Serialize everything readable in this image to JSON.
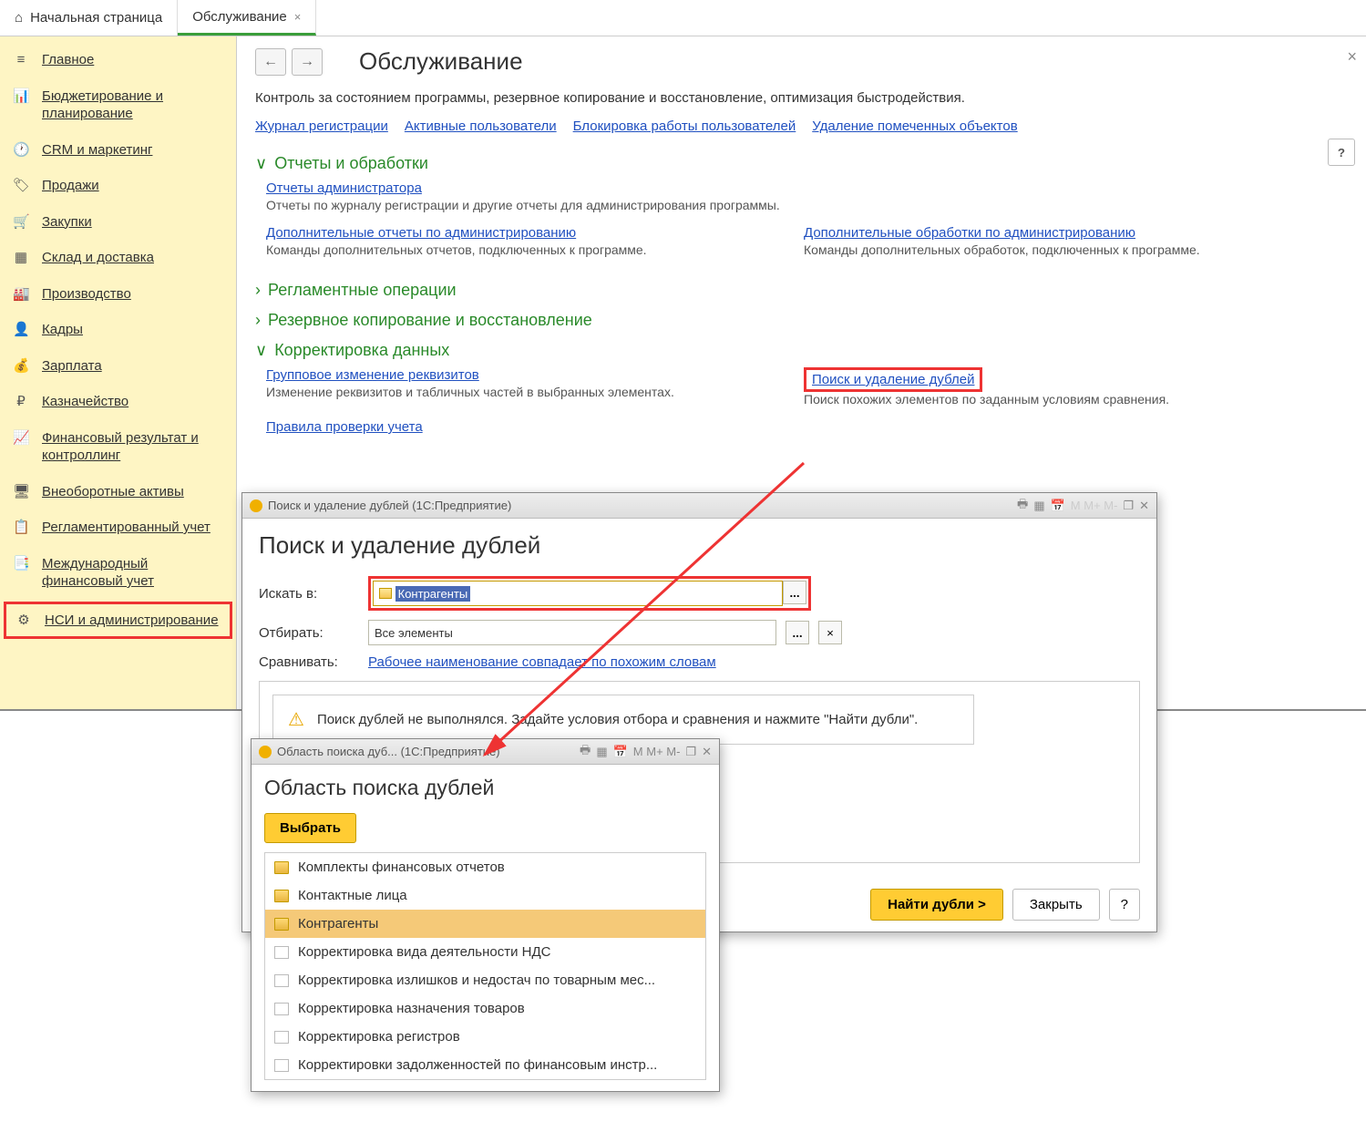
{
  "tabs": {
    "home": "Начальная страница",
    "active": "Обслуживание"
  },
  "sidebar": [
    {
      "icon": "≡",
      "label": "Главное"
    },
    {
      "icon": "📊",
      "label": "Бюджетирование и планирование"
    },
    {
      "icon": "🕐",
      "label": "CRM и маркетинг"
    },
    {
      "icon": "🏷",
      "label": "Продажи"
    },
    {
      "icon": "🛒",
      "label": "Закупки"
    },
    {
      "icon": "▦",
      "label": "Склад и доставка"
    },
    {
      "icon": "🏭",
      "label": "Производство"
    },
    {
      "icon": "👤",
      "label": "Кадры"
    },
    {
      "icon": "💰",
      "label": "Зарплата"
    },
    {
      "icon": "₽",
      "label": "Казначейство"
    },
    {
      "icon": "📈",
      "label": "Финансовый результат и контроллинг"
    },
    {
      "icon": "🖥",
      "label": "Внеоборотные активы"
    },
    {
      "icon": "📋",
      "label": "Регламентированный учет"
    },
    {
      "icon": "📑",
      "label": "Международный финансовый учет"
    },
    {
      "icon": "⚙",
      "label": "НСИ и администрирование"
    }
  ],
  "main": {
    "title": "Обслуживание",
    "desc": "Контроль за состоянием программы, резервное копирование и восстановление, оптимизация быстродействия.",
    "links": [
      "Журнал регистрации",
      "Активные пользователи",
      "Блокировка работы пользователей",
      "Удаление помеченных объектов"
    ],
    "s1": {
      "head": "Отчеты и обработки",
      "l1": "Отчеты администратора",
      "d1": "Отчеты по журналу регистрации и другие отчеты для администрирования программы.",
      "l2": "Дополнительные отчеты по администрированию",
      "d2": "Команды дополнительных отчетов, подключенных к программе.",
      "l3": "Дополнительные обработки по администрированию",
      "d3": "Команды дополнительных обработок, подключенных к программе."
    },
    "s2": "Регламентные операции",
    "s3": "Резервное копирование и восстановление",
    "s4": {
      "head": "Корректировка данных",
      "l1": "Групповое изменение реквизитов",
      "d1": "Изменение реквизитов и табличных частей в выбранных элементах.",
      "l2": "Поиск и удаление дублей",
      "d2": "Поиск похожих элементов по заданным условиям сравнения.",
      "l3": "Правила проверки учета"
    }
  },
  "d1": {
    "wintitle": "Поиск и удаление дублей  (1С:Предприятие)",
    "title": "Поиск и удаление дублей",
    "lbl_search": "Искать в:",
    "val_search": "Контрагенты",
    "lbl_filter": "Отбирать:",
    "val_filter": "Все элементы",
    "lbl_cmp": "Сравнивать:",
    "val_cmp": "Рабочее наименование совпадает по похожим словам",
    "msg": "Поиск дублей не выполнялся.  Задайте условия отбора и сравнения и нажмите \"Найти дубли\".",
    "btn_find": "Найти дубли >",
    "btn_close": "Закрыть",
    "btn_help": "?",
    "tb": "M M+ M-"
  },
  "d2": {
    "wintitle": "Область поиска дуб...  (1С:Предприятие)",
    "title": "Область поиска дублей",
    "btn_select": "Выбрать",
    "tb": "M M+ M-",
    "items": [
      {
        "t": "f",
        "label": "Комплекты финансовых отчетов"
      },
      {
        "t": "f",
        "label": "Контактные лица"
      },
      {
        "t": "f",
        "label": "Контрагенты",
        "sel": true
      },
      {
        "t": "d",
        "label": "Корректировка вида деятельности НДС"
      },
      {
        "t": "d",
        "label": "Корректировка излишков и недостач по товарным мес..."
      },
      {
        "t": "d",
        "label": "Корректировка назначения товаров"
      },
      {
        "t": "d",
        "label": "Корректировка регистров"
      },
      {
        "t": "d",
        "label": "Корректировки задолженностей по финансовым инстр..."
      }
    ]
  }
}
